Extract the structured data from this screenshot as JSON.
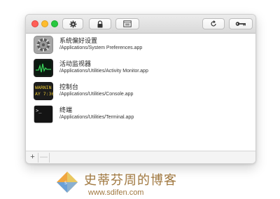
{
  "window": {
    "controls": [
      "close",
      "minimize",
      "zoom"
    ],
    "toolbar_icons": [
      "gear-icon",
      "lock-icon",
      "window-icon",
      "refresh-icon",
      "key-icon"
    ]
  },
  "apps": [
    {
      "name": "系统偏好设置",
      "path": "/Applications/System Preferences.app",
      "icon": "system-preferences-icon"
    },
    {
      "name": "活动监视器",
      "path": "/Applications/Utilities/Activity Monitor.app",
      "icon": "activity-monitor-icon"
    },
    {
      "name": "控制台",
      "path": "/Applications/Utilities/Console.app",
      "icon": "console-icon",
      "icon_text": [
        "WARNIN",
        "AY 7:36"
      ]
    },
    {
      "name": "终端",
      "path": "/Applications/Utilities/Terminal.app",
      "icon": "terminal-icon",
      "icon_text": ">_"
    }
  ],
  "bottom_bar": {
    "add_label": "+",
    "remove_label": "—"
  },
  "watermark": {
    "title": "史蒂芬周的博客",
    "url": "www.sdifen.com",
    "color": "#a07840"
  }
}
